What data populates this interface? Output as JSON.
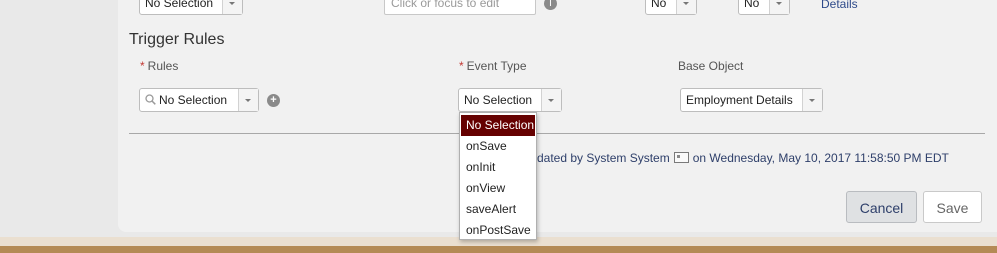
{
  "top_row": {
    "select1_value": "No Selection",
    "input_placeholder": "Click or focus to edit",
    "select2_value": "No",
    "select3_value": "No",
    "details_link": "Details"
  },
  "trigger_rules": {
    "title": "Trigger Rules",
    "rules_label": "Rules",
    "rules_value": "No Selection",
    "event_type_label": "Event Type",
    "event_type_value": "No Selection",
    "base_object_label": "Base Object",
    "base_object_value": "Employment Details",
    "required_marker": "*"
  },
  "event_type_dropdown": {
    "options": [
      "No Selection",
      "onSave",
      "onInit",
      "onView",
      "saveAlert",
      "onPostSave"
    ],
    "selected": "No Selection"
  },
  "audit": {
    "prefix": "dated by System System",
    "suffix": "on Wednesday, May 10, 2017 11:58:50 PM EDT"
  },
  "actions": {
    "cancel_label": "Cancel",
    "save_label": "Save"
  },
  "colors": {
    "dropdown_selected_bg": "#650000",
    "required": "#c23934",
    "footer_stripe": "#b48a55"
  }
}
